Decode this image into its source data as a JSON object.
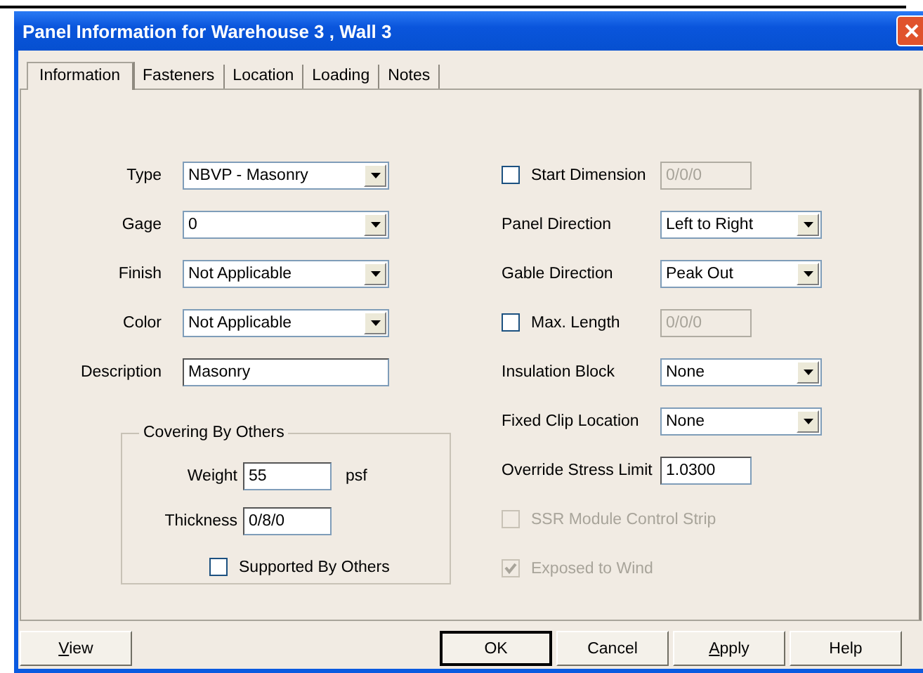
{
  "window": {
    "title": "Panel Information for Warehouse 3 , Wall 3"
  },
  "tabs": [
    {
      "label": "Information",
      "selected": true
    },
    {
      "label": "Fasteners",
      "selected": false
    },
    {
      "label": "Location",
      "selected": false
    },
    {
      "label": "Loading",
      "selected": false
    },
    {
      "label": "Notes",
      "selected": false
    }
  ],
  "left_fields": [
    {
      "kind": "dropdown",
      "label": "Type",
      "value": "NBVP - Masonry"
    },
    {
      "kind": "dropdown",
      "label": "Gage",
      "value": "0"
    },
    {
      "kind": "dropdown",
      "label": "Finish",
      "value": "Not Applicable"
    },
    {
      "kind": "dropdown",
      "label": "Color",
      "value": "Not Applicable"
    },
    {
      "kind": "text",
      "label": "Description",
      "value": "Masonry"
    }
  ],
  "covering_by_others": {
    "title": "Covering By Others",
    "weight": {
      "label": "Weight",
      "value": "55",
      "unit": "psf"
    },
    "thickness": {
      "label": "Thickness",
      "value": "0/8/0"
    },
    "supported": {
      "label": "Supported By Others",
      "checked": false
    }
  },
  "right_fields": [
    {
      "kind": "check_field",
      "label": "Start Dimension",
      "checked": false,
      "value": "0/0/0",
      "field_disabled": true
    },
    {
      "kind": "dropdown",
      "label": "Panel Direction",
      "value": "Left to Right"
    },
    {
      "kind": "dropdown",
      "label": "Gable Direction",
      "value": "Peak Out"
    },
    {
      "kind": "check_field",
      "label": "Max. Length",
      "checked": false,
      "value": "0/0/0",
      "field_disabled": true
    },
    {
      "kind": "dropdown",
      "label": "Insulation Block",
      "value": "None"
    },
    {
      "kind": "dropdown",
      "label": "Fixed Clip Location",
      "value": "None"
    },
    {
      "kind": "text",
      "label": "Override Stress Limit",
      "value": "1.0300"
    },
    {
      "kind": "checkbox",
      "label": "SSR Module Control Strip",
      "checked": false,
      "disabled": true
    },
    {
      "kind": "checkbox",
      "label": "Exposed to Wind",
      "checked": true,
      "disabled": true
    }
  ],
  "buttons": [
    {
      "label": "View",
      "mnemonic": true,
      "default": false
    },
    {
      "label": "OK",
      "mnemonic": false,
      "default": true
    },
    {
      "label": "Cancel",
      "mnemonic": false,
      "default": false
    },
    {
      "label": "Apply",
      "mnemonic": true,
      "default": false
    },
    {
      "label": "Help",
      "mnemonic": false,
      "default": false
    }
  ]
}
